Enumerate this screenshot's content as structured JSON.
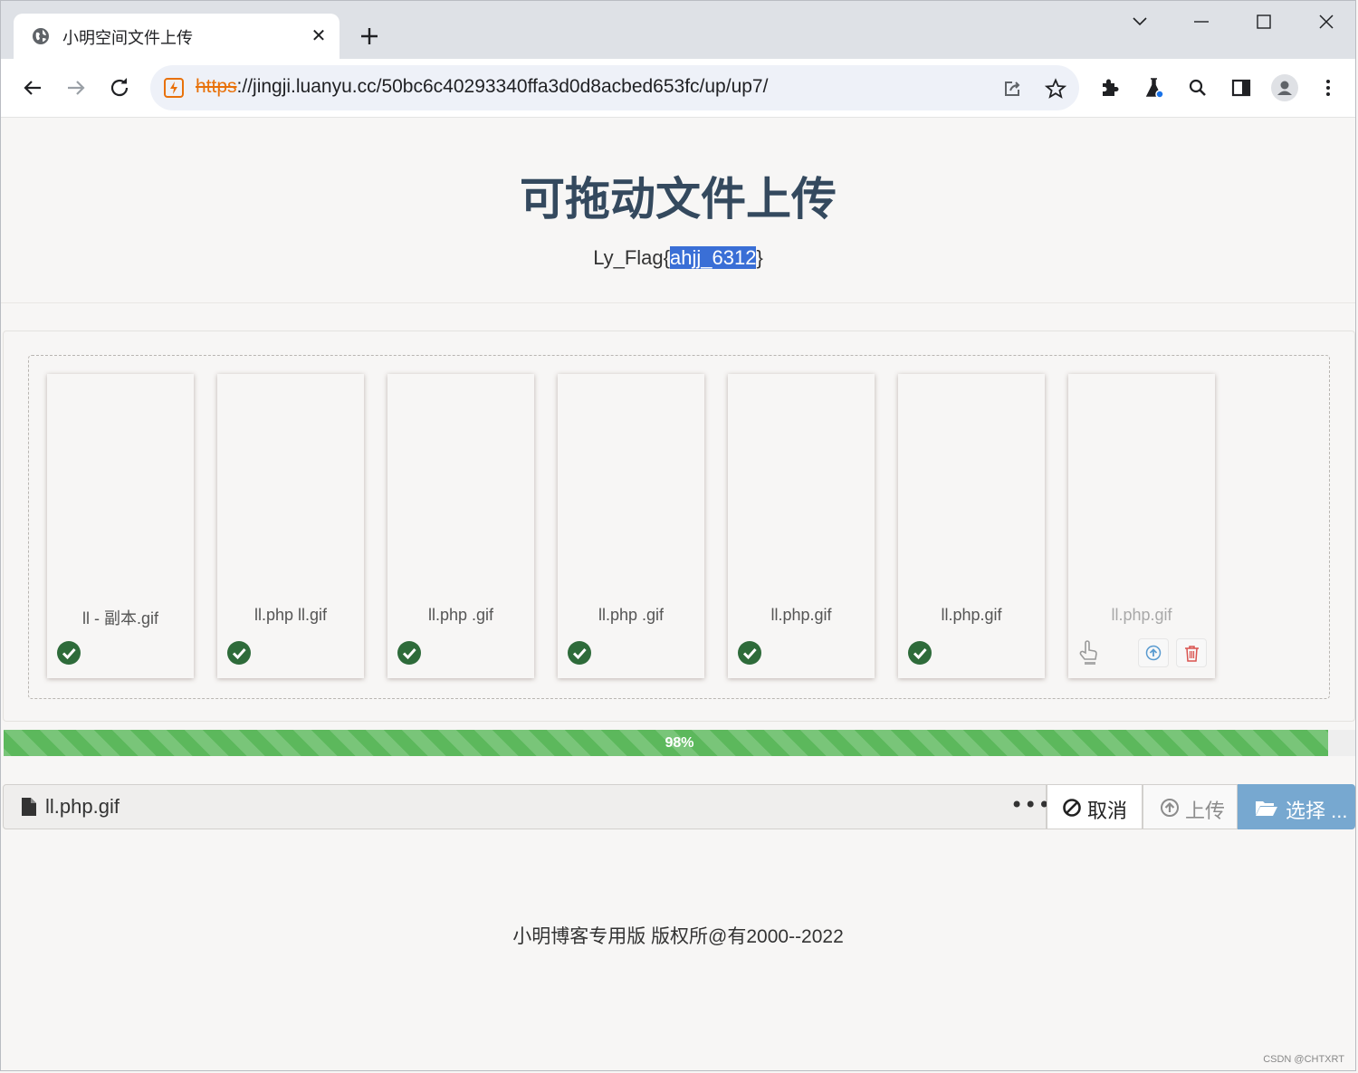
{
  "browser": {
    "tab_title": "小明空间文件上传",
    "url_scheme": "https",
    "url_rest": "://jingji.luanyu.cc/50bc6c40293340ffa3d0d8acbed653fc/up/up7/"
  },
  "page": {
    "title": "可拖动文件上传",
    "flag_prefix": "Ly_Flag{",
    "flag_value": "ahjj_6312",
    "flag_suffix": "}"
  },
  "files": [
    {
      "name": "ll - 副本.gif",
      "status": "uploaded"
    },
    {
      "name": "ll.php ll.gif",
      "status": "uploaded"
    },
    {
      "name": "ll.php .gif",
      "status": "uploaded"
    },
    {
      "name": "ll.php .gif",
      "status": "uploaded"
    },
    {
      "name": "ll.php.gif",
      "status": "uploaded"
    },
    {
      "name": "ll.php.gif",
      "status": "uploaded"
    },
    {
      "name": "ll.php.gif",
      "status": "pending"
    }
  ],
  "progress": {
    "percent": 98,
    "label": "98%"
  },
  "upload_bar": {
    "filename": "ll.php.gif",
    "more": "•••",
    "cancel_label": "取消",
    "upload_label": "上传",
    "select_label": "选择 ..."
  },
  "footer": {
    "text": "小明博客专用版 版权所@有2000--2022"
  },
  "watermark": "CSDN @CHTXRT",
  "colors": {
    "accent": "#77a8d0",
    "progress": "#5cb85c",
    "success": "#2e6b3a",
    "title": "#34495e"
  }
}
